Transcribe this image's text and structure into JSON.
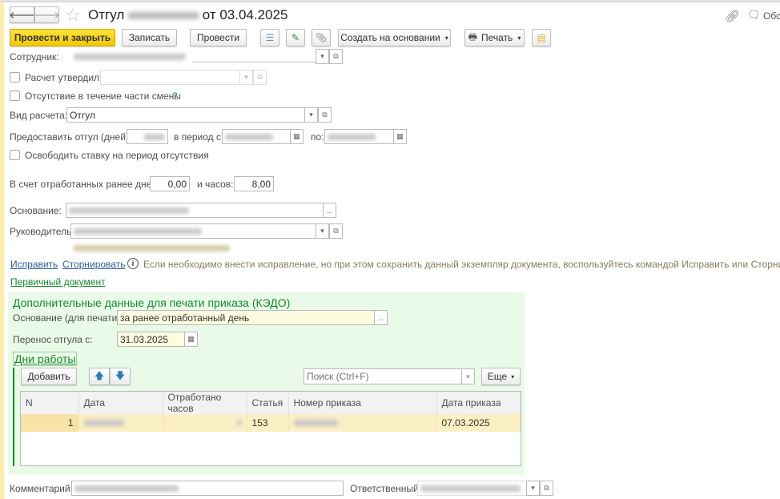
{
  "window": {
    "title_prefix": "Отгул",
    "title_suffix": "от 03.04.2025",
    "discuss_label": "Обс"
  },
  "toolbar": {
    "post_and_close": "Провести и закрыть",
    "save": "Записать",
    "post": "Провести",
    "create_based_on": "Создать на основании",
    "print": "Печать"
  },
  "form": {
    "employee_label": "Сотрудник:",
    "calc_approved_label": "Расчет утвердил",
    "partial_shift_label": "Отсутствие в течение части смены",
    "help_mark": "?",
    "calc_type_label": "Вид расчета:",
    "calc_type_value": "Отгул",
    "grant_days_label": "Предоставить отгул (дней):",
    "period_from_label": "в период с:",
    "period_to_label": "по:",
    "free_rate_label": "Освободить ставку на период отсутствия",
    "worked_days_label": "В счет отработанных ранее дней:",
    "worked_days_value": "0,00",
    "hours_label": "и часов:",
    "hours_value": "8,00",
    "basis_label": "Основание:",
    "basis_button": "...",
    "manager_label": "Руководитель:",
    "fix_link": "Исправить",
    "storno_link": "Сторнировать",
    "info_text": "Если необходимо внести исправление, но при этом сохранить данный экземпляр документа, воспользуйтесь командой Исправить или Сторнировать",
    "primary_doc_link": "Первичный документ",
    "comment_label": "Комментарий:",
    "responsible_label": "Ответственный:"
  },
  "kedo": {
    "title": "Дополнительные данные для печати приказа (КЭДО)",
    "print_basis_label": "Основание (для печати):",
    "print_basis_value": "за ранее отработанный день",
    "print_basis_button": "...",
    "transfer_label": "Перенос отгула с:",
    "transfer_value": "31.03.2025",
    "work_days_group": "Дни работы",
    "add_button": "Добавить",
    "search_placeholder": "Поиск (Ctrl+F)",
    "search_clear": "×",
    "more_button": "Еще",
    "columns": [
      "N",
      "Дата",
      "Отработано часов",
      "Статья",
      "Номер приказа",
      "Дата приказа"
    ],
    "rows": [
      {
        "n": "1",
        "article": "153",
        "order_date": "07.03.2025"
      }
    ]
  },
  "colors": {
    "primary_button": "#f5d40f",
    "green_panel": "#e9fbe8",
    "selected_row": "#fbefc4",
    "link": "#2c5c9c",
    "green_text": "#168a2a"
  }
}
